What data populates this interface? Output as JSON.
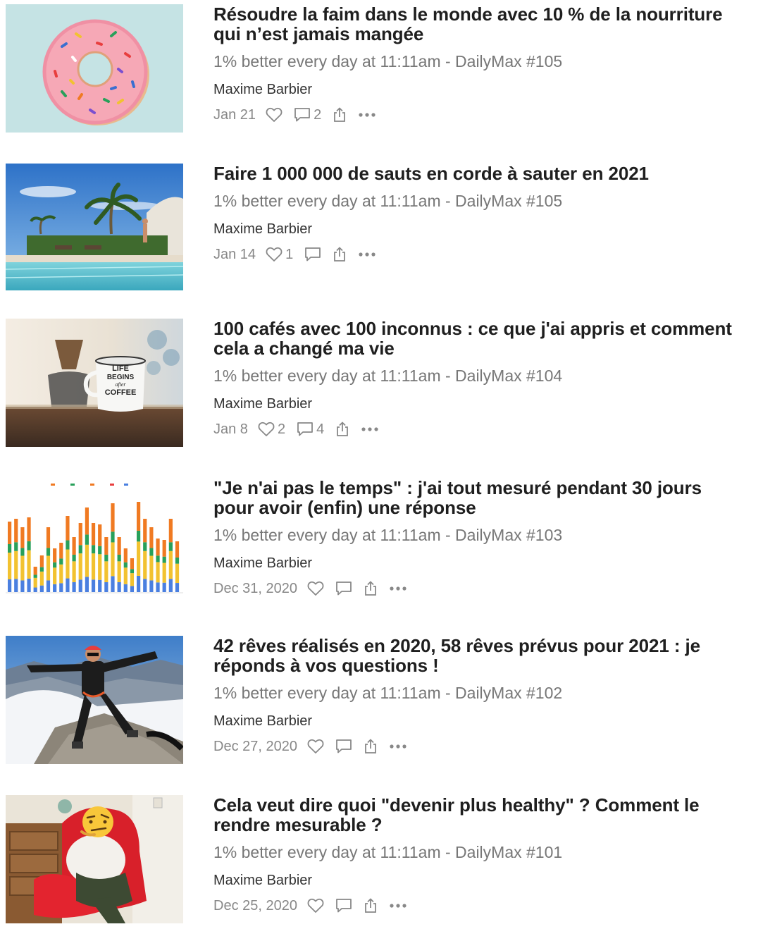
{
  "posts": [
    {
      "title_line1": "Résoudre la faim dans le monde avec 10 % de la nourriture",
      "title_line2": "qui n’est jamais mangée",
      "subtitle": "1% better every day at 11:11am - DailyMax #105",
      "author": "Maxime Barbier",
      "date": "Jan 21",
      "likes": "",
      "comments": "2",
      "thumb": "pink-donut-on-light-blue"
    },
    {
      "title_line1": "Faire 1 000 000 de sauts en corde à sauter en 2021",
      "title_line2": "",
      "subtitle": "1% better every day at 11:11am - DailyMax #105",
      "author": "Maxime Barbier",
      "date": "Jan 14",
      "likes": "1",
      "comments": "",
      "thumb": "pool-with-palm-trees"
    },
    {
      "title_line1": "100 cafés avec 100 inconnus : ce que j'ai appris et comment",
      "title_line2": "cela a changé ma vie",
      "subtitle": "1% better every day at 11:11am - DailyMax #104",
      "author": "Maxime Barbier",
      "date": "Jan 8",
      "likes": "2",
      "comments": "4",
      "thumb": "coffee-mug-life-begins-after-coffee"
    },
    {
      "title_line1": "\"Je n'ai pas le temps\" : j'ai tout mesuré pendant 30 jours",
      "title_line2": "pour avoir (enfin) une réponse",
      "subtitle": "1% better every day at 11:11am - DailyMax #103",
      "author": "Maxime Barbier",
      "date": "Dec 31, 2020",
      "likes": "",
      "comments": "",
      "thumb": "stacked-bar-chart"
    },
    {
      "title_line1": "42 rêves réalisés en 2020, 58 rêves prévus pour 2021 : je",
      "title_line2": "réponds à vos questions !",
      "subtitle": "1% better every day at 11:11am - DailyMax #102",
      "author": "Maxime Barbier",
      "date": "Dec 27, 2020",
      "likes": "",
      "comments": "",
      "thumb": "mountaineer-on-summit"
    },
    {
      "title_line1": "Cela veut dire quoi \"devenir plus healthy\" ? Comment le",
      "title_line2": "rendre mesurable ?",
      "subtitle": "1% better every day at 11:11am - DailyMax #101",
      "author": "Maxime Barbier",
      "date": "Dec 25, 2020",
      "likes": "",
      "comments": "",
      "thumb": "person-in-red-armchair-emoji-face"
    }
  ],
  "thumb_images": {
    "mug_text_line1": "LIFE",
    "mug_text_line2": "BEGINS",
    "mug_text_line3": "after",
    "mug_text_line4": "COFFEE"
  },
  "icons": {
    "like": "heart-icon",
    "comment": "comment-bubble-icon",
    "share": "share-icon",
    "more": "more-dots-icon"
  },
  "colors": {
    "title": "#1f1f1f",
    "subtitle": "#777777",
    "meta": "#888888",
    "chart_blue": "#4a7fe0",
    "chart_yellow": "#f2c230",
    "chart_green": "#28a05a",
    "chart_orange": "#f07a22"
  }
}
